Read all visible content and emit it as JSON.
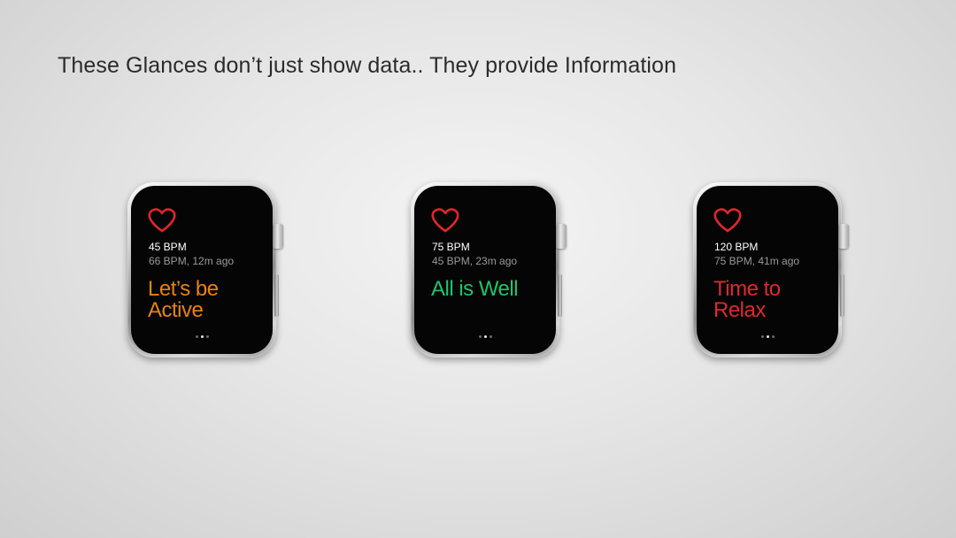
{
  "slide": {
    "title": "These Glances don’t just show data.. They provide Information"
  },
  "heart_icon_color": "#e0262c",
  "watches": [
    {
      "icon": "heart-icon",
      "bpm_current": "45 BPM",
      "bpm_previous": "66 BPM, 12m ago",
      "message_line1": "Let’s be",
      "message_line2": "Active",
      "message_color": "#e8820f"
    },
    {
      "icon": "heart-icon",
      "bpm_current": "75 BPM",
      "bpm_previous": "45 BPM, 23m ago",
      "message_line1": "All is Well",
      "message_line2": "",
      "message_color": "#1fc36a"
    },
    {
      "icon": "heart-icon",
      "bpm_current": "120 BPM",
      "bpm_previous": "75 BPM, 41m ago",
      "message_line1": "Time to",
      "message_line2": "Relax",
      "message_color": "#e0282c"
    }
  ],
  "page_indicator": {
    "count": 3,
    "active_index": 1
  }
}
